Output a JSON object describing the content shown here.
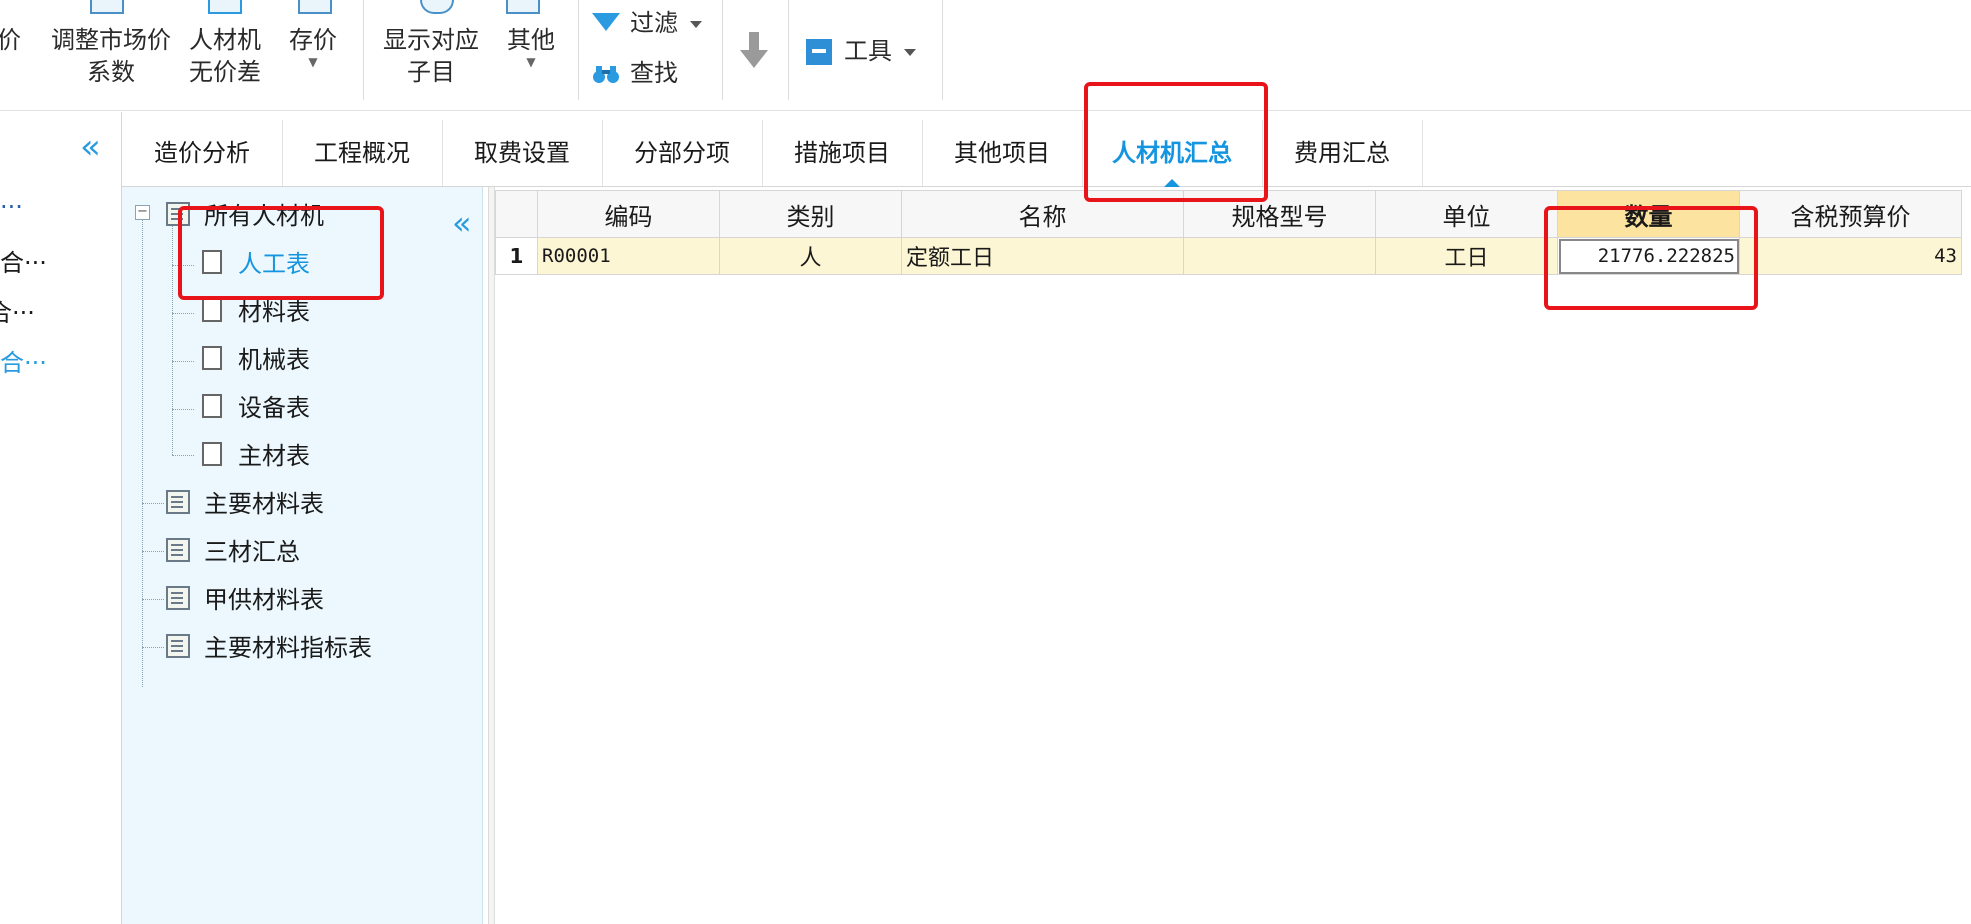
{
  "toolbar": {
    "partial_left": "价",
    "adjust_market_line1": "调整市场价",
    "adjust_market_line2": "系数",
    "rcj_line1": "人材机",
    "rcj_line2": "无价差",
    "save_price": "存价",
    "show_match_line1": "显示对应",
    "show_match_line2": "子目",
    "other": "其他",
    "filter": "过滤",
    "find": "查找",
    "tools": "工具"
  },
  "left_strip": {
    "items": [
      "···",
      "合···",
      "合···",
      "合···"
    ]
  },
  "tabs": [
    {
      "label": "造价分析"
    },
    {
      "label": "工程概况"
    },
    {
      "label": "取费设置"
    },
    {
      "label": "分部分项"
    },
    {
      "label": "措施项目"
    },
    {
      "label": "其他项目"
    },
    {
      "label": "人材机汇总"
    },
    {
      "label": "费用汇总"
    }
  ],
  "active_tab": "人材机汇总",
  "tree": {
    "root": "所有人材机",
    "children": [
      "人工表",
      "材料表",
      "机械表",
      "设备表",
      "主材表"
    ],
    "selected": "人工表",
    "reports": [
      "主要材料表",
      "三材汇总",
      "甲供材料表",
      "主要材料指标表"
    ],
    "collapse_symbol": "«",
    "expander_symbol": "−"
  },
  "grid": {
    "columns": [
      "编码",
      "类别",
      "名称",
      "规格型号",
      "单位",
      "数量",
      "含税预算价"
    ],
    "highlighted_column": "数量",
    "rows": [
      {
        "num": "1",
        "code": "R00001",
        "category": "人",
        "name": "定额工日",
        "spec": "",
        "unit": "工日",
        "qty": "21776.222825",
        "price": "43"
      }
    ]
  },
  "colors": {
    "accent": "#1595e0",
    "highlight_box": "#e8141a",
    "tree_bg": "#ecf8fd",
    "row_bg": "#fdf6d4",
    "header_highlight": "#fde3a0"
  }
}
